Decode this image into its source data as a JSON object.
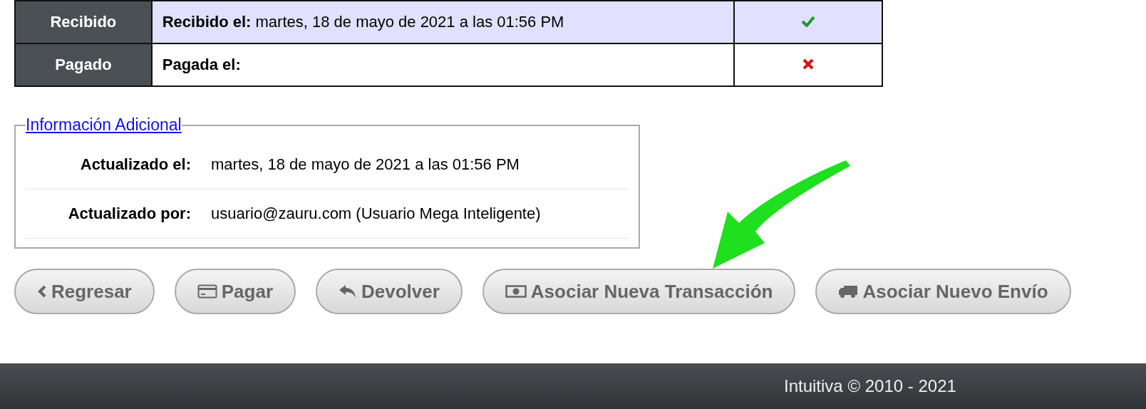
{
  "status_table": {
    "rows": [
      {
        "header": "Recibido",
        "label": "Recibido el:",
        "value": "martes, 18 de mayo de 2021 a las 01:56 PM",
        "highlighted": true,
        "done": true
      },
      {
        "header": "Pagado",
        "label": "Pagada el:",
        "value": "",
        "highlighted": false,
        "done": false
      }
    ]
  },
  "additional_info": {
    "legend": "Información Adicional",
    "rows": [
      {
        "label": "Actualizado el:",
        "value": "martes, 18 de mayo de 2021 a las 01:56 PM"
      },
      {
        "label": "Actualizado por:",
        "value": "usuario@zauru.com (Usuario Mega Inteligente)"
      }
    ]
  },
  "buttons": [
    {
      "label": "Regresar",
      "kind": "back"
    },
    {
      "label": "Pagar",
      "kind": "card"
    },
    {
      "label": "Devolver",
      "kind": "reply"
    },
    {
      "label": "Asociar Nueva Transacción",
      "kind": "money"
    },
    {
      "label": "Asociar Nuevo Envío",
      "kind": "truck"
    }
  ],
  "footer": {
    "text": "Intuitiva © 2010 - 2021"
  }
}
